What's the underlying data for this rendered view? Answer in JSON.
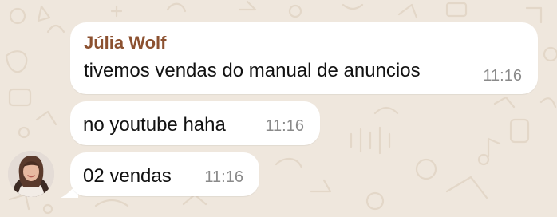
{
  "chat": {
    "messages": [
      {
        "sender": "Júlia Wolf",
        "text": "tivemos vendas do manual de anuncios",
        "time": "11:16"
      },
      {
        "text": "no youtube haha",
        "time": "11:16"
      },
      {
        "text": "02 vendas",
        "time": "11:16"
      }
    ]
  },
  "colors": {
    "wallpaper": "#efe7dd",
    "bubble": "#ffffff",
    "sender_name": "#8c5130",
    "timestamp": "#8a8a8a"
  },
  "icons": {
    "avatar": "sender-avatar-photo"
  }
}
